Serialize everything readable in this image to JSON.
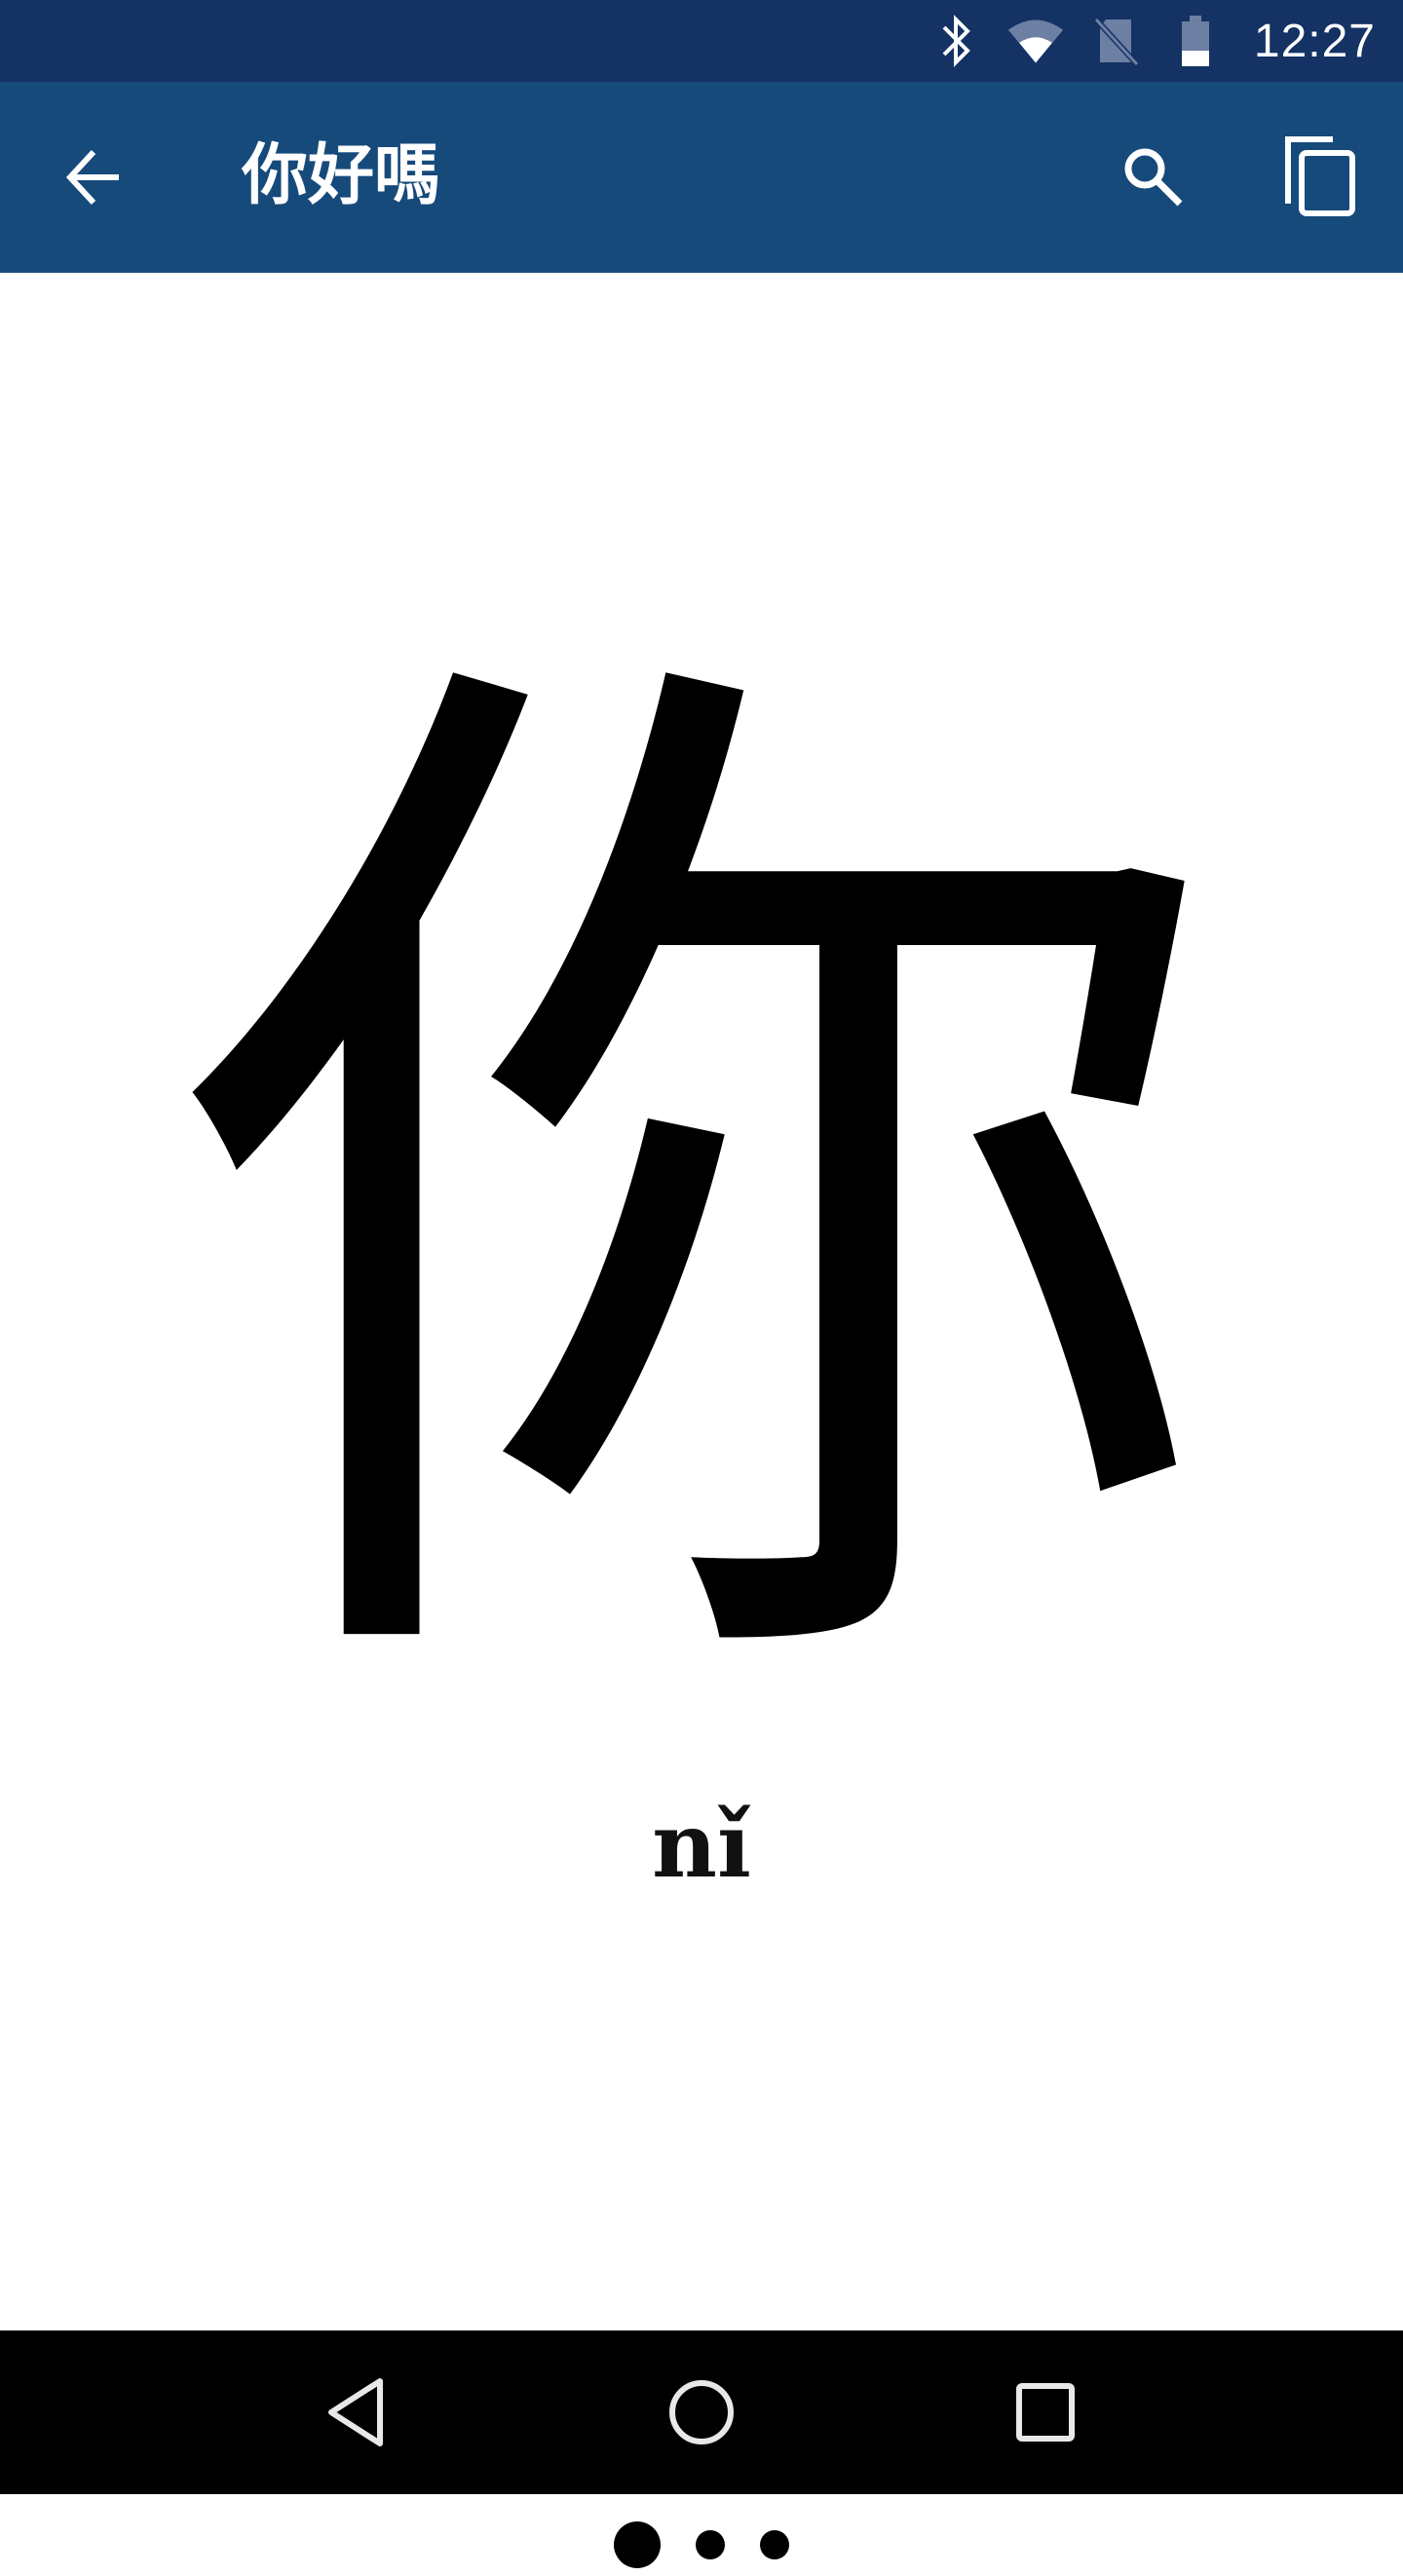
{
  "status_bar": {
    "time": "12:27",
    "icons": [
      "bluetooth-icon",
      "wifi-icon",
      "no-sim-icon",
      "battery-icon"
    ]
  },
  "app_bar": {
    "title": "你好嗎",
    "back_icon": "arrow-left-icon",
    "search_icon": "search-icon",
    "copy_icon": "copy-icon",
    "background": "#164a7b"
  },
  "card": {
    "character": "你",
    "pinyin": "nǐ"
  },
  "pager": {
    "page_count": 3,
    "current_page": 1
  },
  "nav_bar": {
    "icons": [
      "back-triangle-icon",
      "home-circle-icon",
      "recents-square-icon"
    ]
  }
}
